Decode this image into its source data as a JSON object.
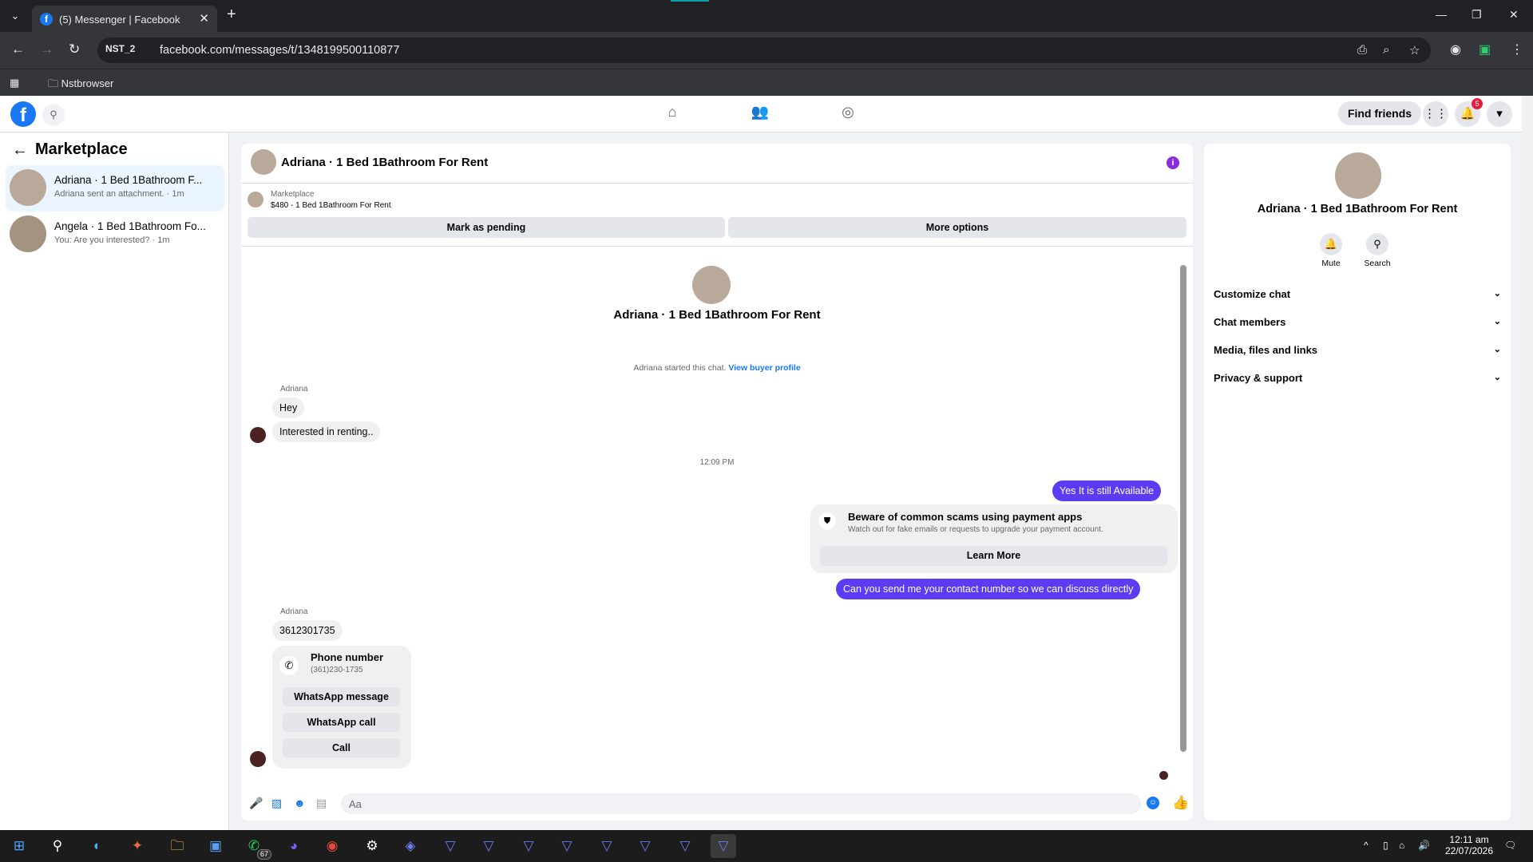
{
  "browser": {
    "tab_title": "(5) Messenger | Facebook",
    "profile_chip": "NST_2",
    "url": "facebook.com/messages/t/1348199500110877",
    "bookmark_folder": "Nstbrowser"
  },
  "header": {
    "find_friends": "Find friends",
    "notification_count": "5"
  },
  "left": {
    "title": "Marketplace",
    "conversations": [
      {
        "name": "Adriana · 1 Bed 1Bathroom F...",
        "last": "Adriana sent an attachment. · 1m"
      },
      {
        "name": "Angela · 1 Bed 1Bathroom Fo...",
        "last": "You: Are you interested? · 1m"
      }
    ]
  },
  "chat": {
    "title": "Adriana · 1 Bed 1Bathroom For Rent",
    "listing_label": "Marketplace",
    "listing_price": "$480 - 1 Bed 1Bathroom For Rent",
    "mark_pending": "Mark as pending",
    "more_options": "More options",
    "intro_name": "Adriana · 1 Bed 1Bathroom For Rent",
    "started_text": "Adriana started this chat.",
    "view_profile": "View buyer profile",
    "sender1": "Adriana",
    "msg1": "Hey",
    "msg2": "Interested in renting..",
    "time": "12:09 PM",
    "out1": "Yes It is still Available",
    "scam_title": "Beware of common scams using payment apps",
    "scam_sub": "Watch out for fake emails or requests to upgrade your payment account.",
    "learn_more": "Learn More",
    "out2": "Can you send me your contact number so we can discuss directly",
    "sender2": "Adriana",
    "msg3": "3612301735",
    "phone_title": "Phone number",
    "phone_number": "(361)230-1735",
    "wa_message": "WhatsApp message",
    "wa_call": "WhatsApp call",
    "call": "Call",
    "composer_placeholder": "Aa"
  },
  "right": {
    "name": "Adriana · 1 Bed 1Bathroom For Rent",
    "mute": "Mute",
    "search": "Search",
    "sections": [
      "Customize chat",
      "Chat members",
      "Media, files and links",
      "Privacy & support"
    ]
  },
  "taskbar": {
    "whatsapp_badge": "67",
    "time": "12:11 am",
    "date": "22/07/2026"
  }
}
